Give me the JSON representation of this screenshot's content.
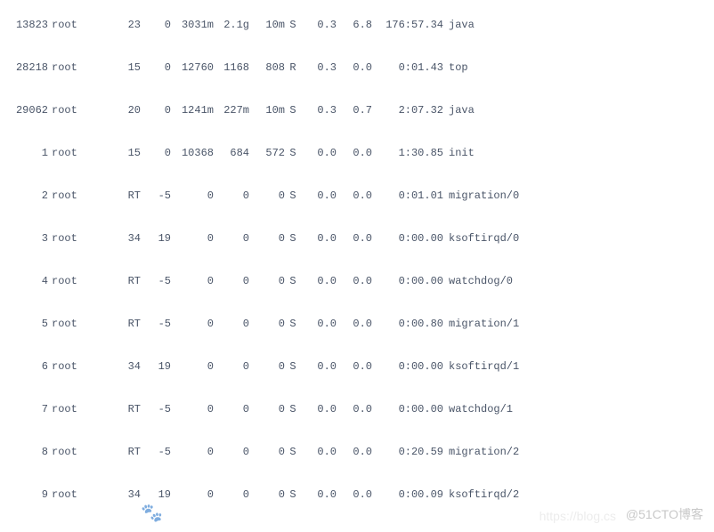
{
  "processes": [
    {
      "pid": "13823",
      "user": "root",
      "pr": "23",
      "ni": "0",
      "virt": "3031m",
      "res": "2.1g",
      "shr": "10m",
      "st": "S",
      "cpu": "0.3",
      "mem": "6.8",
      "time": "176:57.34",
      "cmd": "java"
    },
    {
      "pid": "28218",
      "user": "root",
      "pr": "15",
      "ni": "0",
      "virt": "12760",
      "res": "1168",
      "shr": "808",
      "st": "R",
      "cpu": "0.3",
      "mem": "0.0",
      "time": "0:01.43",
      "cmd": "top"
    },
    {
      "pid": "29062",
      "user": "root",
      "pr": "20",
      "ni": "0",
      "virt": "1241m",
      "res": "227m",
      "shr": "10m",
      "st": "S",
      "cpu": "0.3",
      "mem": "0.7",
      "time": "2:07.32",
      "cmd": "java"
    },
    {
      "pid": "1",
      "user": "root",
      "pr": "15",
      "ni": "0",
      "virt": "10368",
      "res": "684",
      "shr": "572",
      "st": "S",
      "cpu": "0.0",
      "mem": "0.0",
      "time": "1:30.85",
      "cmd": "init"
    },
    {
      "pid": "2",
      "user": "root",
      "pr": "RT",
      "ni": "-5",
      "virt": "0",
      "res": "0",
      "shr": "0",
      "st": "S",
      "cpu": "0.0",
      "mem": "0.0",
      "time": "0:01.01",
      "cmd": "migration/0"
    },
    {
      "pid": "3",
      "user": "root",
      "pr": "34",
      "ni": "19",
      "virt": "0",
      "res": "0",
      "shr": "0",
      "st": "S",
      "cpu": "0.0",
      "mem": "0.0",
      "time": "0:00.00",
      "cmd": "ksoftirqd/0"
    },
    {
      "pid": "4",
      "user": "root",
      "pr": "RT",
      "ni": "-5",
      "virt": "0",
      "res": "0",
      "shr": "0",
      "st": "S",
      "cpu": "0.0",
      "mem": "0.0",
      "time": "0:00.00",
      "cmd": "watchdog/0"
    },
    {
      "pid": "5",
      "user": "root",
      "pr": "RT",
      "ni": "-5",
      "virt": "0",
      "res": "0",
      "shr": "0",
      "st": "S",
      "cpu": "0.0",
      "mem": "0.0",
      "time": "0:00.80",
      "cmd": "migration/1"
    },
    {
      "pid": "6",
      "user": "root",
      "pr": "34",
      "ni": "19",
      "virt": "0",
      "res": "0",
      "shr": "0",
      "st": "S",
      "cpu": "0.0",
      "mem": "0.0",
      "time": "0:00.00",
      "cmd": "ksoftirqd/1"
    },
    {
      "pid": "7",
      "user": "root",
      "pr": "RT",
      "ni": "-5",
      "virt": "0",
      "res": "0",
      "shr": "0",
      "st": "S",
      "cpu": "0.0",
      "mem": "0.0",
      "time": "0:00.00",
      "cmd": "watchdog/1"
    },
    {
      "pid": "8",
      "user": "root",
      "pr": "RT",
      "ni": "-5",
      "virt": "0",
      "res": "0",
      "shr": "0",
      "st": "S",
      "cpu": "0.0",
      "mem": "0.0",
      "time": "0:20.59",
      "cmd": "migration/2"
    },
    {
      "pid": "9",
      "user": "root",
      "pr": "34",
      "ni": "19",
      "virt": "0",
      "res": "0",
      "shr": "0",
      "st": "S",
      "cpu": "0.0",
      "mem": "0.0",
      "time": "0:00.09",
      "cmd": "ksoftirqd/2"
    }
  ],
  "watermark": {
    "right": "@51CTO博客",
    "faded": "https://blog.cs",
    "paw": "🐾"
  }
}
